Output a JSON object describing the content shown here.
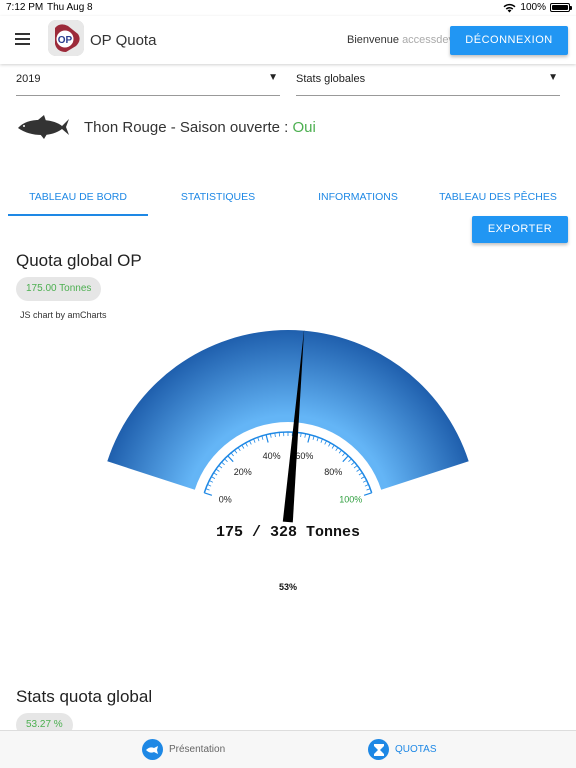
{
  "status_bar": {
    "time": "7:12 PM",
    "date": "Thu Aug 8",
    "battery": "100%"
  },
  "app_bar": {
    "title": "OP Quota",
    "welcome": "Bienvenue",
    "user": "accessdev",
    "logout_label": "DÉCONNEXION",
    "logo_text": "OP"
  },
  "filters": {
    "year": "2019",
    "view": "Stats globales"
  },
  "species": {
    "name_prefix": "Thon Rouge - Saison ouverte :",
    "season_status": "Oui"
  },
  "tabs": [
    {
      "label": "TABLEAU DE BORD",
      "active": true
    },
    {
      "label": "STATISTIQUES",
      "active": false
    },
    {
      "label": "INFORMATIONS",
      "active": false
    },
    {
      "label": "TABLEAU DES PÊCHES",
      "active": false
    }
  ],
  "export_label": "EXPORTER",
  "quota_section": {
    "title": "Quota global OP",
    "chip": "175.00 Tonnes",
    "credit": "JS chart by amCharts"
  },
  "gauge": {
    "value_label": "175 / 328 Tonnes",
    "percent_label": "53%",
    "value": 175,
    "max": 328,
    "ticks": [
      "0%",
      "20%",
      "40%",
      "60%",
      "80%",
      "100%"
    ]
  },
  "stats_section": {
    "title": "Stats quota global",
    "chip": "53.27 %"
  },
  "bottom_nav": [
    {
      "label": "Présentation",
      "icon": "fish-icon",
      "active": false
    },
    {
      "label": "QUOTAS",
      "icon": "hourglass-icon",
      "active": true
    }
  ],
  "colors": {
    "accent": "#2196f3",
    "green": "#4caf50",
    "gauge_dark": "#1565c0",
    "gauge_light": "#42a5f5"
  }
}
